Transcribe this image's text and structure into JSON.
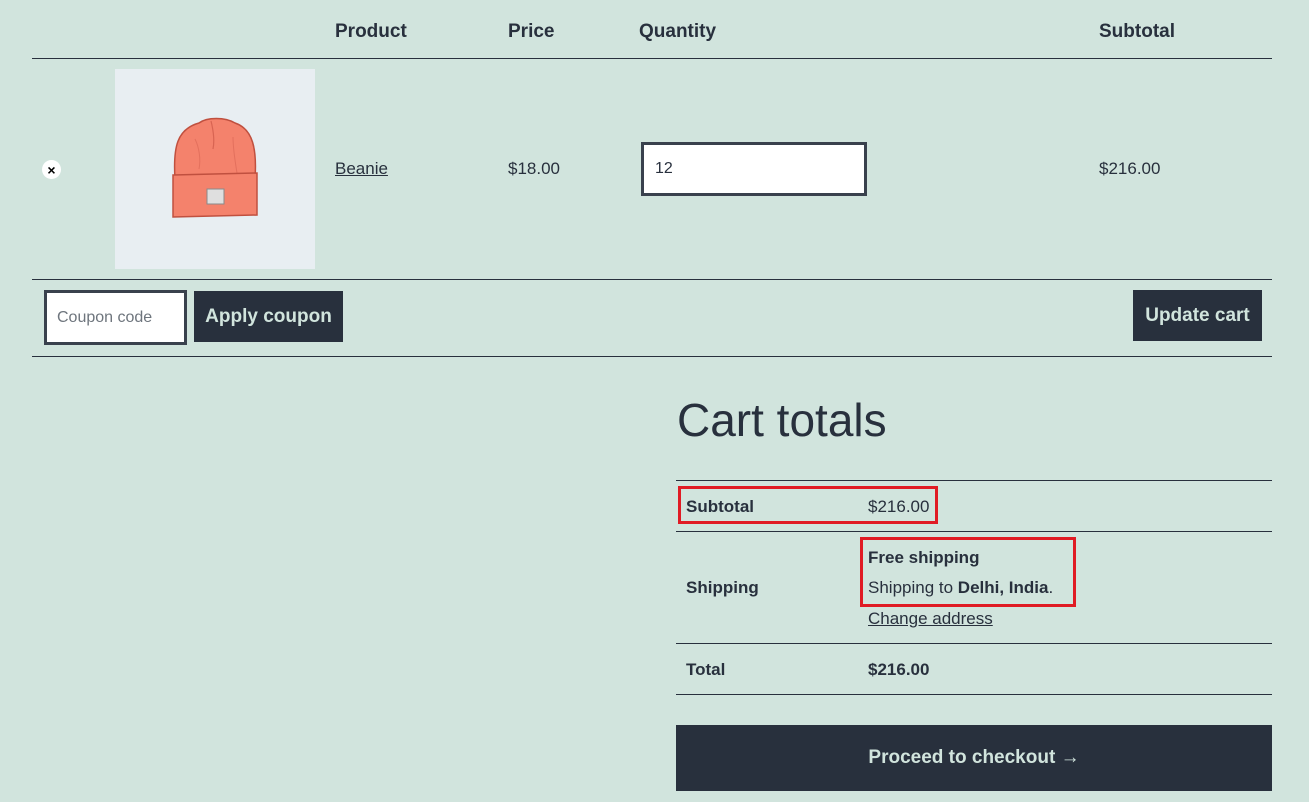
{
  "table": {
    "headers": {
      "product": "Product",
      "price": "Price",
      "quantity": "Quantity",
      "subtotal": "Subtotal"
    },
    "rows": [
      {
        "remove_label": "×",
        "image_icon": "beanie-image",
        "name": "Beanie",
        "price": "$18.00",
        "quantity": "12",
        "subtotal": "$216.00"
      }
    ]
  },
  "actions": {
    "coupon_placeholder": "Coupon code",
    "apply_label": "Apply coupon",
    "update_label": "Update cart"
  },
  "totals": {
    "title": "Cart totals",
    "subtotal_label": "Subtotal",
    "subtotal_value": "$216.00",
    "shipping_label": "Shipping",
    "shipping_method": "Free shipping",
    "shipping_to_prefix": "Shipping to ",
    "shipping_destination": "Delhi, India",
    "shipping_to_suffix": ".",
    "change_address": "Change address",
    "total_label": "Total",
    "total_value": "$216.00",
    "checkout_label": "Proceed to checkout →"
  },
  "colors": {
    "background": "#d1e4dd",
    "text": "#28303d",
    "highlight": "#e01b24"
  }
}
